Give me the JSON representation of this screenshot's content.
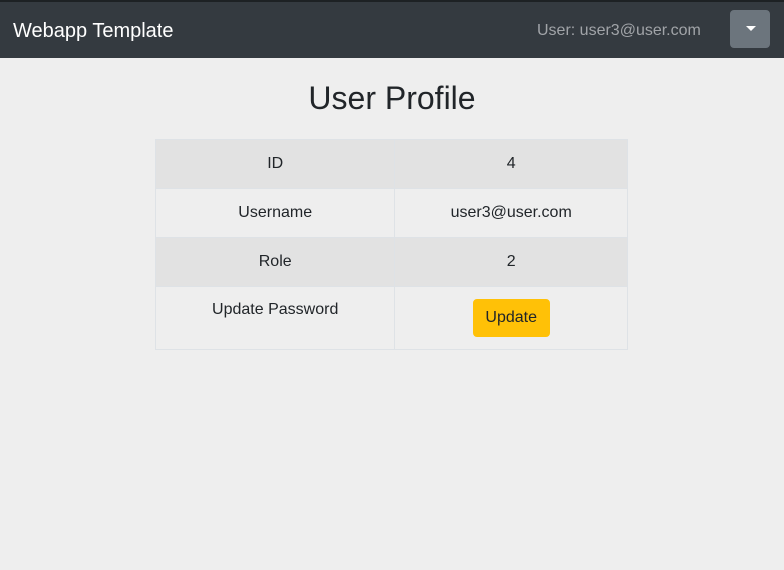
{
  "navbar": {
    "brand": "Webapp Template",
    "user_text": "User: user3@user.com",
    "dropdown_icon": "caret-down-icon"
  },
  "page": {
    "title": "User Profile"
  },
  "profile": {
    "rows": [
      {
        "label": "ID",
        "value": "4"
      },
      {
        "label": "Username",
        "value": "user3@user.com"
      },
      {
        "label": "Role",
        "value": "2"
      },
      {
        "label": "Update Password",
        "button_label": "Update"
      }
    ]
  },
  "colors": {
    "navbar_bg": "#343a40",
    "page_bg": "#eeeeee",
    "dropdown_btn": "#6c757d",
    "update_btn": "#ffc107",
    "striped_row": "#e2e2e2"
  }
}
